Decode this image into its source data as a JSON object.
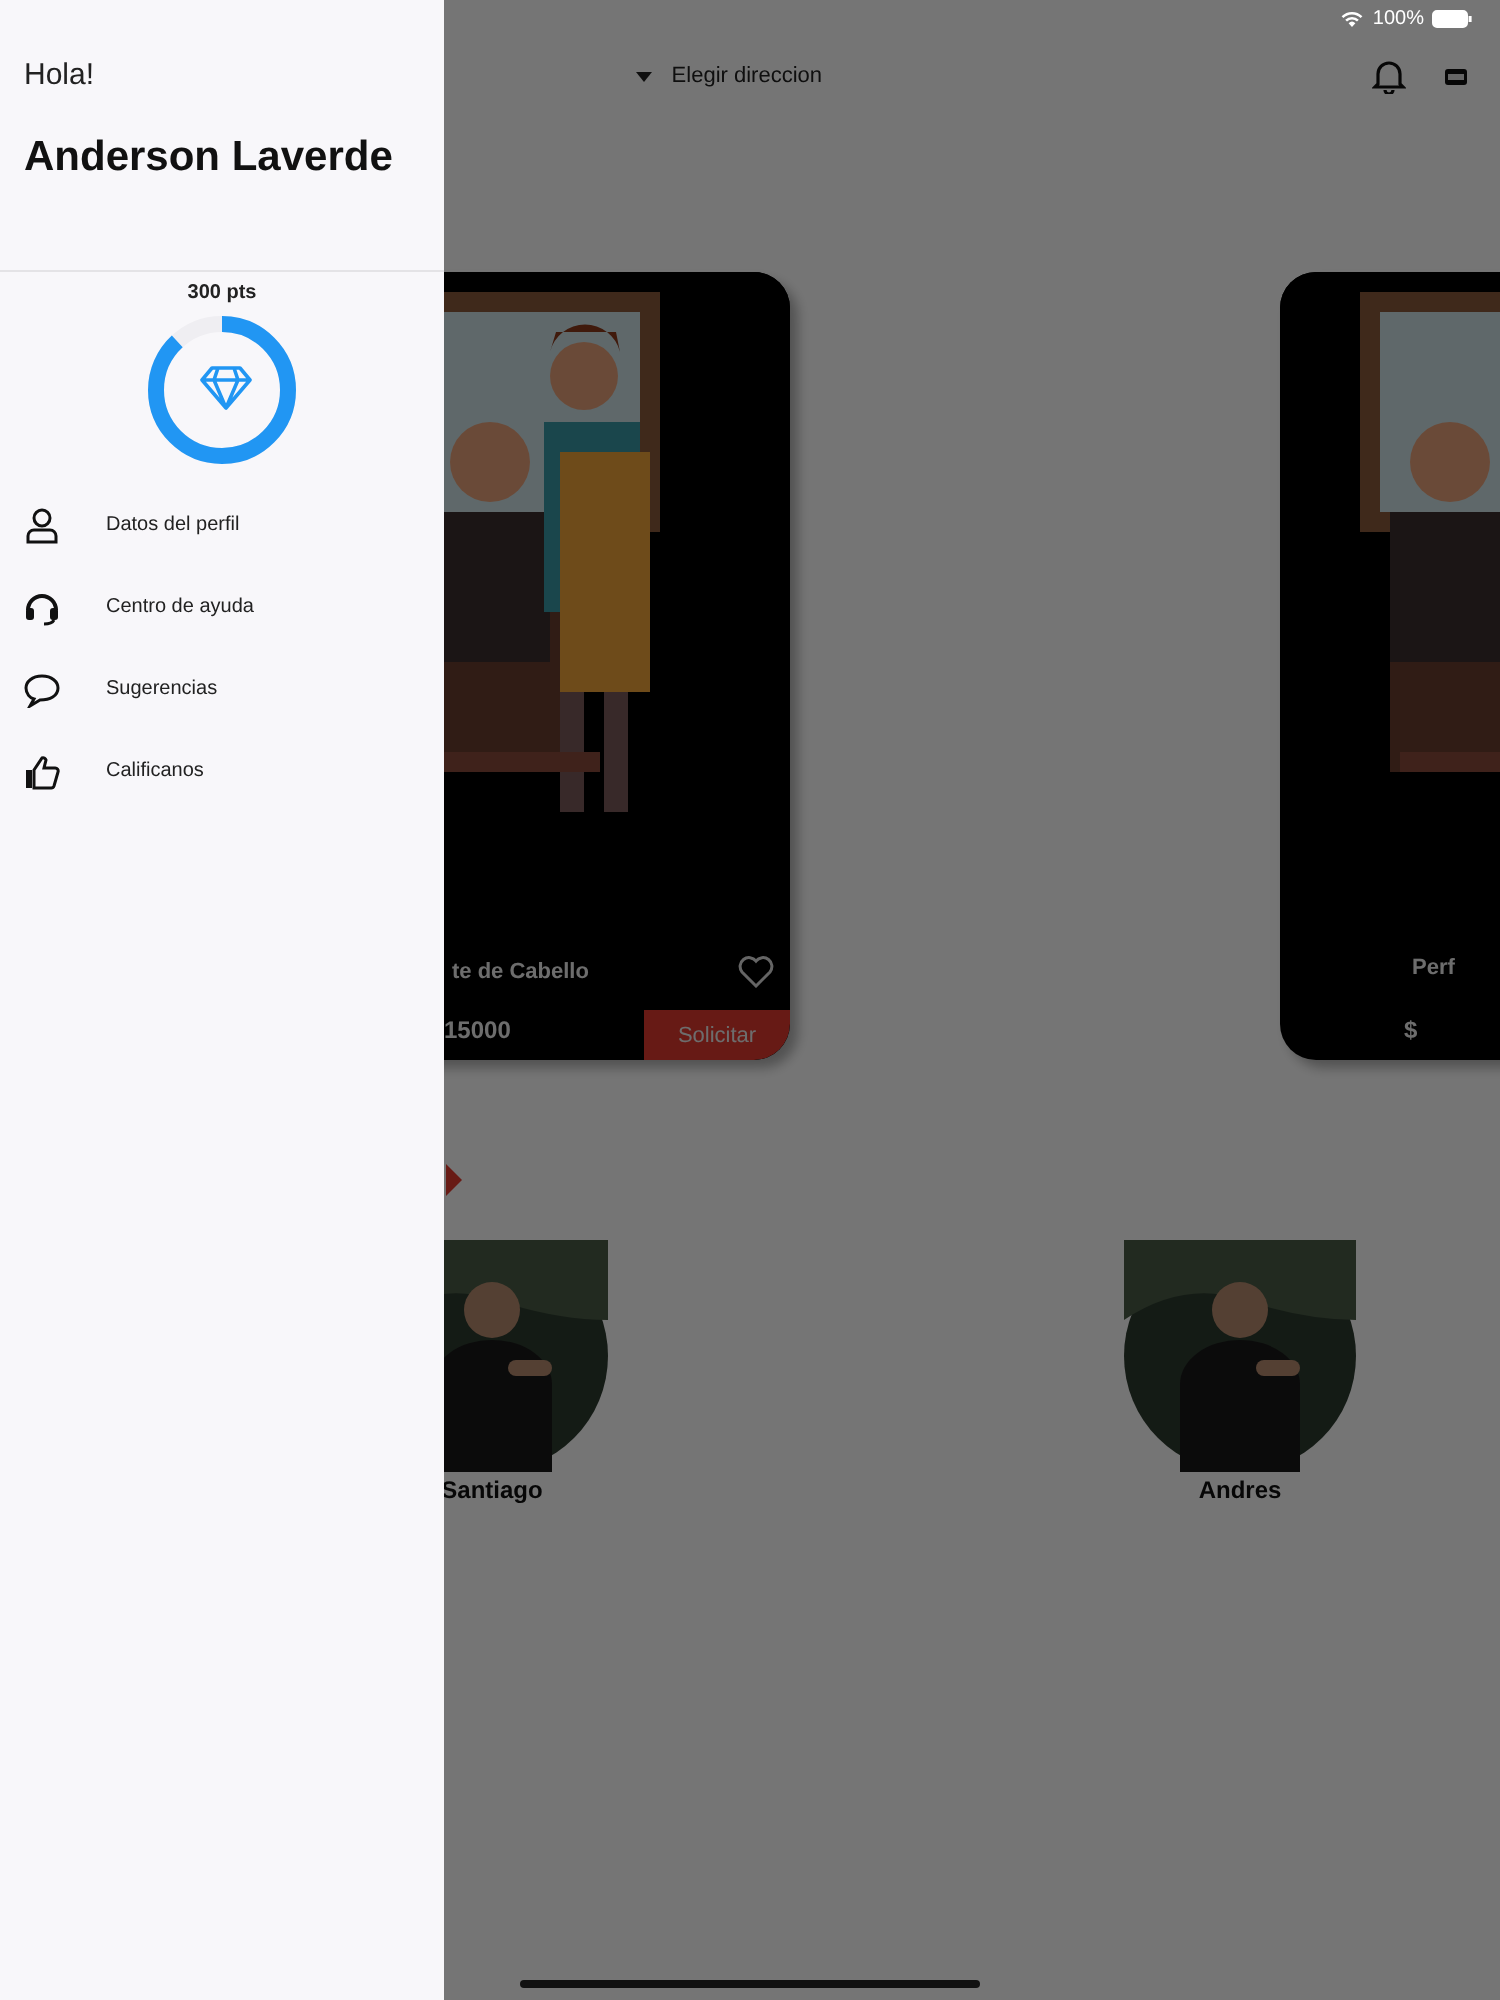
{
  "status_bar": {
    "battery": "100%"
  },
  "top_bar": {
    "address": "Elegir direccion"
  },
  "services": [
    {
      "title": "te de Cabello",
      "price": "15000",
      "button": "Solicitar",
      "favorite": false
    },
    {
      "title": "Perf",
      "price": "$"
    }
  ],
  "barbers": [
    {
      "name": "Santiago",
      "kind": "picture"
    },
    {
      "name": "Andres",
      "kind": "picture"
    }
  ],
  "drawer": {
    "greeting": "Hola!",
    "user_name": "Anderson Laverde",
    "points": "300 pts",
    "level": 0.88,
    "menu": [
      {
        "label": "Datos del perfil"
      },
      {
        "label": "Centro de ayuda"
      },
      {
        "label": "Sugerencias"
      },
      {
        "label": "Calificanos"
      }
    ]
  }
}
